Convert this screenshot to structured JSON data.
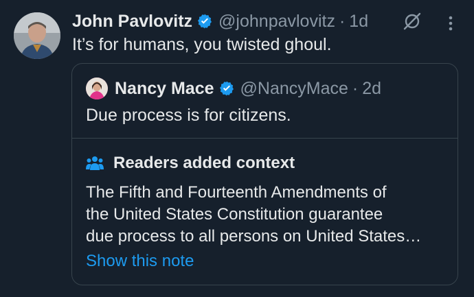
{
  "tweet": {
    "author_name": "John Pavlovitz",
    "handle": "@johnpavlovitz",
    "separator": "·",
    "time": "1d",
    "text": "It’s for humans, you twisted ghoul."
  },
  "quoted_tweet": {
    "author_name": "Nancy Mace",
    "handle": "@NancyMace",
    "separator": "·",
    "time": "2d",
    "text": "Due process is for citizens."
  },
  "community_note": {
    "title": "Readers added context",
    "body_lines": [
      "The Fifth and Fourteenth Amendments of",
      "the United States Constitution guarantee",
      "due process to all persons on United States…"
    ],
    "link": "Show this note"
  },
  "colors": {
    "background": "#16202c",
    "verified": "#1d9bf0",
    "link": "#1d9bf0",
    "muted": "#8b98a5"
  },
  "icons": {
    "verified": "verified-badge-icon",
    "grok": "grok-icon",
    "more": "more-options-icon",
    "people": "people-icon"
  }
}
